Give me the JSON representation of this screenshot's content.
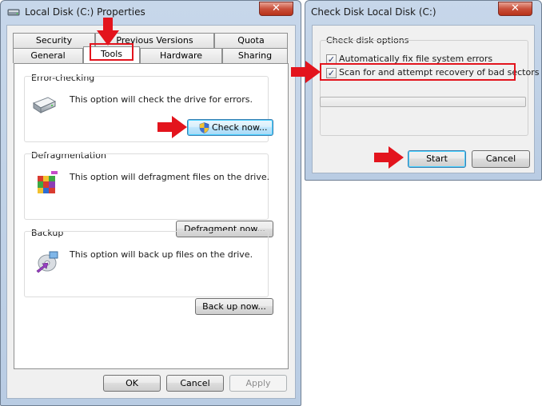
{
  "main_window": {
    "title": "Local Disk (C:) Properties",
    "close_glyph": "✕",
    "tabs_row1": [
      {
        "label": "Security"
      },
      {
        "label": "Previous Versions"
      },
      {
        "label": "Quota"
      }
    ],
    "tabs_row2": [
      {
        "label": "General"
      },
      {
        "label": "Tools",
        "active": true
      },
      {
        "label": "Hardware"
      },
      {
        "label": "Sharing"
      }
    ],
    "sections": {
      "error_checking": {
        "title": "Error-checking",
        "text": "This option will check the drive for errors.",
        "button": "Check now...",
        "icon": "drive-icon"
      },
      "defragmentation": {
        "title": "Defragmentation",
        "text": "This option will defragment files on the drive.",
        "button": "Defragment now...",
        "icon": "defragment-icon"
      },
      "backup": {
        "title": "Backup",
        "text": "This option will back up files on the drive.",
        "button": "Back up now...",
        "icon": "backup-icon"
      }
    },
    "footer": {
      "ok": "OK",
      "cancel": "Cancel",
      "apply": "Apply"
    }
  },
  "check_disk_dialog": {
    "title": "Check Disk Local Disk (C:)",
    "close_glyph": "✕",
    "group_title": "Check disk options",
    "options": [
      {
        "label": "Automatically fix file system errors",
        "checked": true
      },
      {
        "label": "Scan for and attempt recovery of bad sectors",
        "checked": true
      }
    ],
    "progress": 0,
    "start": "Start",
    "cancel": "Cancel"
  },
  "annotation_color": "#e3141d",
  "check_glyph": "✓"
}
